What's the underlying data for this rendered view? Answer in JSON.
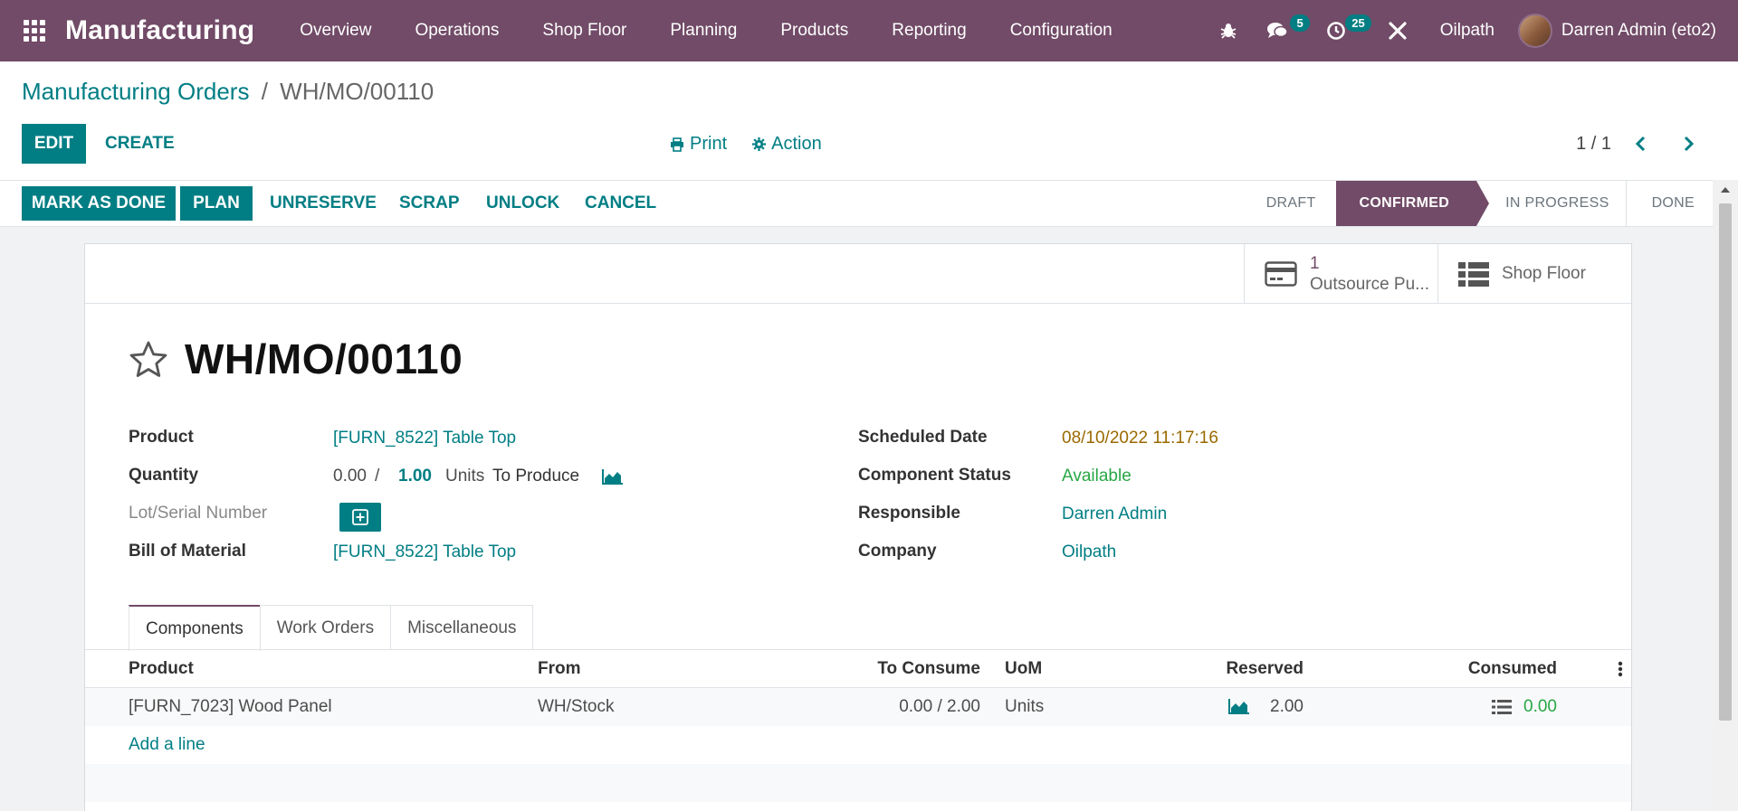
{
  "navbar": {
    "brand": "Manufacturing",
    "menu": [
      "Overview",
      "Operations",
      "Shop Floor",
      "Planning",
      "Products",
      "Reporting",
      "Configuration"
    ],
    "messages_count": "5",
    "activities_count": "25",
    "company": "Oilpath",
    "user": "Darren Admin (eto2)"
  },
  "breadcrumb": {
    "parent": "Manufacturing Orders",
    "separator": "/",
    "current": "WH/MO/00110"
  },
  "control": {
    "edit_label": "EDIT",
    "create_label": "CREATE",
    "print_label": "Print",
    "action_label": "Action",
    "pager": "1 / 1"
  },
  "statusbar": {
    "buttons": {
      "mark_done": "MARK AS DONE",
      "plan": "PLAN",
      "unreserve": "UNRESERVE",
      "scrap": "SCRAP",
      "unlock": "UNLOCK",
      "cancel": "CANCEL"
    },
    "stages": [
      "DRAFT",
      "CONFIRMED",
      "IN PROGRESS",
      "DONE"
    ],
    "active_stage": "CONFIRMED"
  },
  "smart_buttons": {
    "outsource_count": "1",
    "outsource_label": "Outsource Pu...",
    "shop_floor_label": "Shop Floor"
  },
  "record": {
    "title": "WH/MO/00110",
    "left_fields": {
      "product_label": "Product",
      "product_value": "[FURN_8522] Table Top",
      "quantity_label": "Quantity",
      "qty_produced": "0.00",
      "qty_sep": "/",
      "qty_total": "1.00",
      "qty_uom": "Units",
      "qty_suffix": "To Produce",
      "lot_label": "Lot/Serial Number",
      "bom_label": "Bill of Material",
      "bom_value": "[FURN_8522] Table Top"
    },
    "right_fields": {
      "scheduled_label": "Scheduled Date",
      "scheduled_value": "08/10/2022 11:17:16",
      "component_status_label": "Component Status",
      "component_status_value": "Available",
      "responsible_label": "Responsible",
      "responsible_value": "Darren Admin",
      "company_label": "Company",
      "company_value": "Oilpath"
    }
  },
  "tabs": [
    "Components",
    "Work Orders",
    "Miscellaneous"
  ],
  "components_table": {
    "headers": [
      "Product",
      "From",
      "To Consume",
      "UoM",
      "Reserved",
      "Consumed"
    ],
    "rows": [
      {
        "product": "[FURN_7023] Wood Panel",
        "from": "WH/Stock",
        "to_consume": "0.00 / 2.00",
        "uom": "Units",
        "reserved": "2.00",
        "consumed": "0.00"
      }
    ],
    "add_line": "Add a line"
  },
  "colors": {
    "primary": "#714b67",
    "accent": "#017e84"
  }
}
